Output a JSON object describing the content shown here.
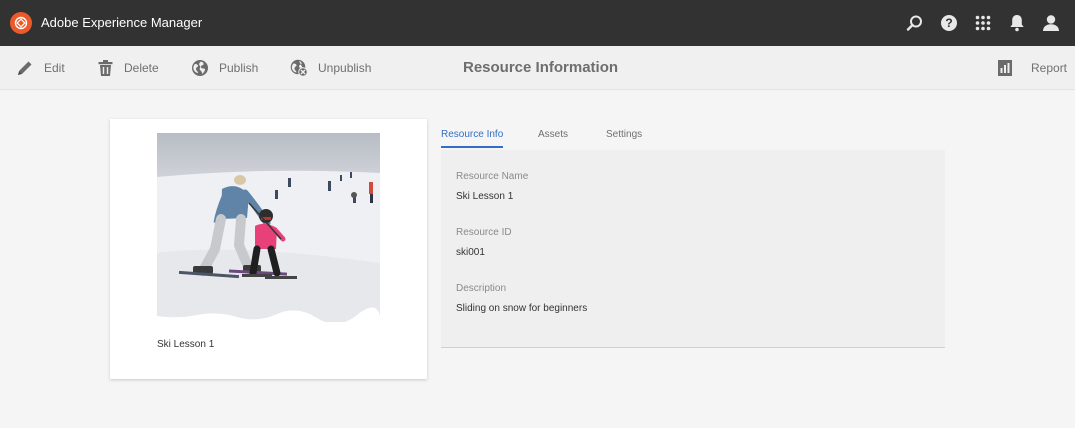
{
  "app": {
    "title": "Adobe Experience Manager"
  },
  "topbar": {
    "icons": [
      "search-icon",
      "help-icon",
      "apps-grid-icon",
      "notifications-bell-icon",
      "user-avatar-icon"
    ]
  },
  "toolbar": {
    "edit_label": "Edit",
    "delete_label": "Delete",
    "publish_label": "Publish",
    "unpublish_label": "Unpublish",
    "page_title": "Resource Information",
    "report_label": "Report"
  },
  "card": {
    "caption": "Ski Lesson 1"
  },
  "tabs": [
    {
      "label": "Resource Info",
      "active": true
    },
    {
      "label": "Assets",
      "active": false
    },
    {
      "label": "Settings",
      "active": false
    }
  ],
  "details": {
    "name_label": "Resource Name",
    "name_value": "Ski Lesson 1",
    "id_label": "Resource ID",
    "id_value": "ski001",
    "description_label": "Description",
    "description_value": "Sliding on snow for beginners"
  },
  "colors": {
    "topbar": "#323232",
    "accent": "#326ec8",
    "logo": "#eb5a2a"
  }
}
